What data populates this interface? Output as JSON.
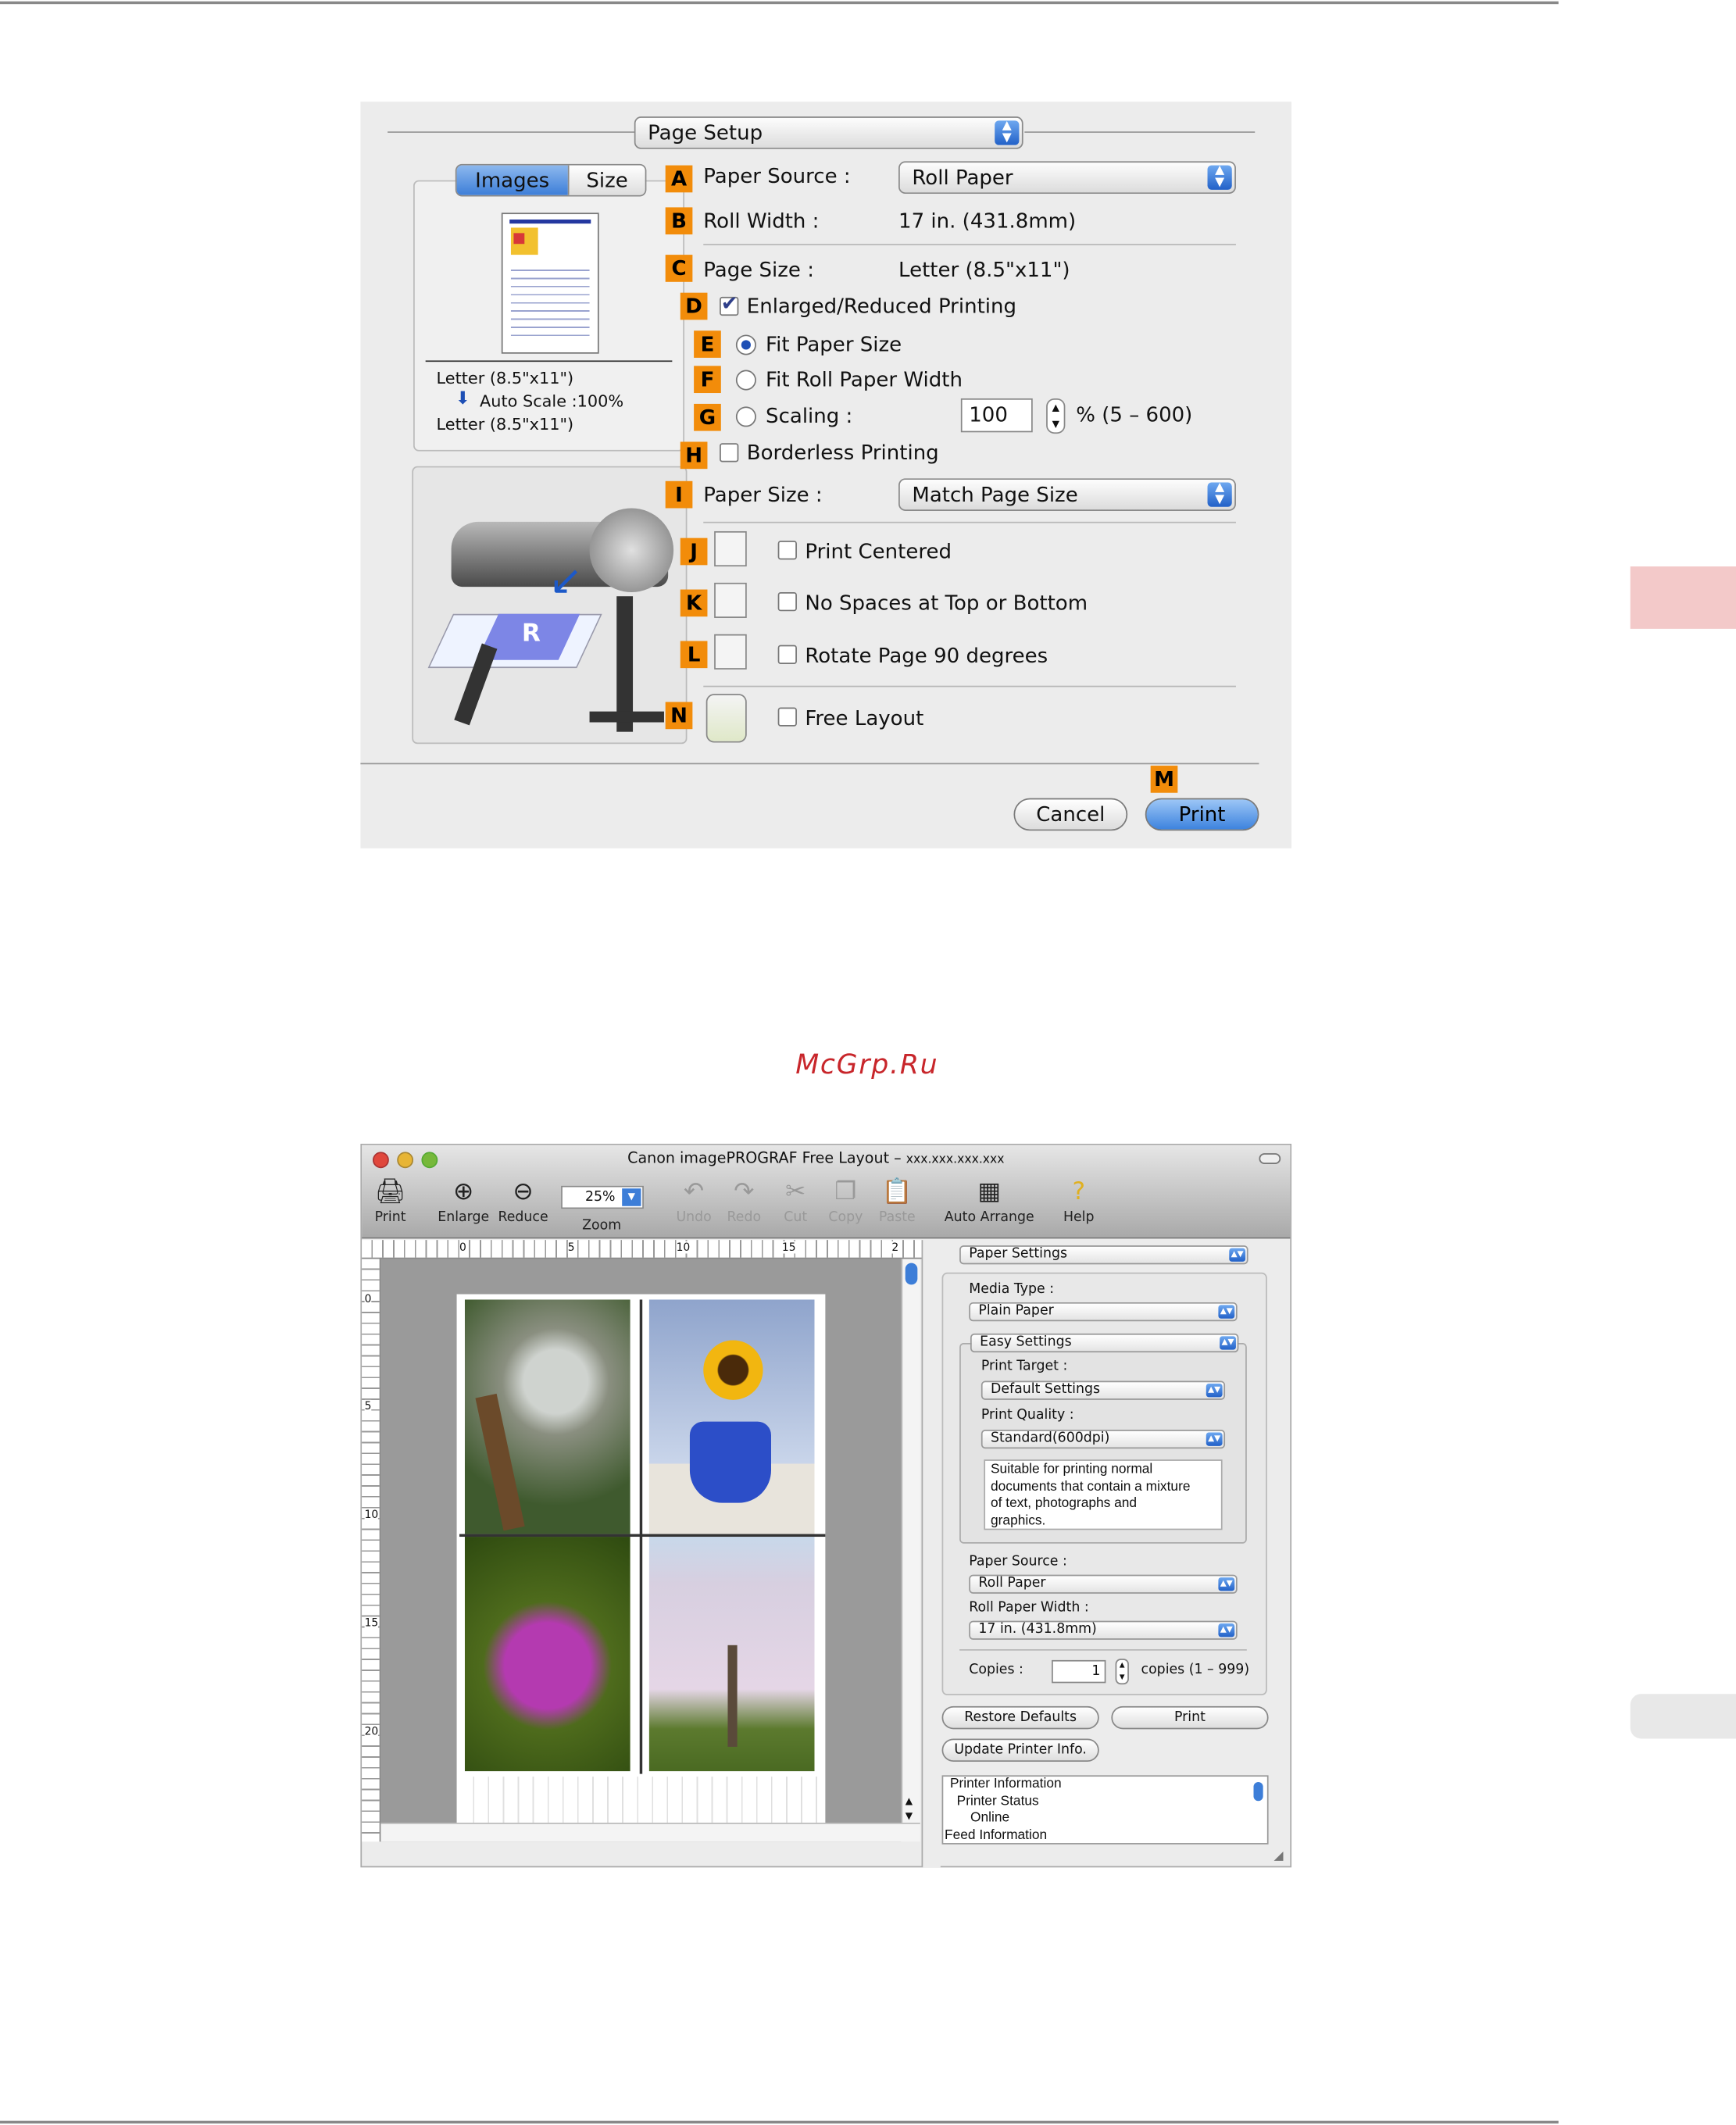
{
  "page_setup": {
    "title_popup": "Page Setup",
    "tabs": [
      "Images",
      "Size"
    ],
    "preview": {
      "line1": "Letter (8.5\"x11\")",
      "line2": "Auto Scale :100%",
      "line3": "Letter (8.5\"x11\")"
    },
    "markers": {
      "a": "A",
      "b": "B",
      "c": "C",
      "d": "D",
      "e": "E",
      "f": "F",
      "g": "G",
      "h": "H",
      "i": "I",
      "j": "J",
      "k": "K",
      "l": "L",
      "n": "N",
      "m": "M"
    },
    "paper_source_label": "Paper Source :",
    "paper_source_value": "Roll Paper",
    "roll_width_label": "Roll Width :",
    "roll_width_value": "17 in. (431.8mm)",
    "page_size_label": "Page Size :",
    "page_size_value": "Letter (8.5\"x11\")",
    "enlarged_reduced": "Enlarged/Reduced Printing",
    "fit_paper_size": "Fit Paper Size",
    "fit_roll_width": "Fit Roll Paper Width",
    "scaling_label": "Scaling :",
    "scaling_value": "100",
    "scaling_range": "% (5 – 600)",
    "borderless": "Borderless Printing",
    "paper_size_label": "Paper Size :",
    "paper_size_value": "Match Page Size",
    "print_centered": "Print Centered",
    "no_spaces": "No Spaces at Top or Bottom",
    "rotate": "Rotate Page 90 degrees",
    "free_layout": "Free Layout",
    "cancel": "Cancel",
    "print": "Print"
  },
  "watermark": "McGrp.Ru",
  "app": {
    "title": "Canon imagePROGRAF Free Layout –",
    "title_suffix": "xxx.xxx.xxx.xxx",
    "toolbar": {
      "print": "Print",
      "enlarge": "Enlarge",
      "reduce": "Reduce",
      "zoom_value": "25%",
      "zoom": "Zoom",
      "undo": "Undo",
      "redo": "Redo",
      "cut": "Cut",
      "copy": "Copy",
      "paste": "Paste",
      "auto_arrange": "Auto Arrange",
      "help": "Help"
    },
    "ruler_h": [
      "0",
      "5",
      "10",
      "15",
      "2"
    ],
    "ruler_v": [
      "0",
      "5",
      "10",
      "15",
      "20"
    ],
    "panel": {
      "top_popup": "Paper Settings",
      "media_type_label": "Media Type :",
      "media_type": "Plain Paper",
      "easy_settings": "Easy Settings",
      "print_target_label": "Print Target :",
      "print_target": "Default Settings",
      "print_quality_label": "Print Quality :",
      "print_quality": "Standard(600dpi)",
      "description": "Suitable for printing normal documents that contain a mixture of text, photographs and graphics.",
      "paper_source_label": "Paper Source :",
      "paper_source": "Roll Paper",
      "roll_width_label": "Roll Paper Width :",
      "roll_width": "17 in. (431.8mm)",
      "copies_label": "Copies :",
      "copies_value": "1",
      "copies_range": "copies (1 – 999)",
      "restore_defaults": "Restore Defaults",
      "print": "Print",
      "update_printer": "Update Printer Info.",
      "info": [
        "Printer Information",
        "Printer Status",
        "Online",
        "Feed Information"
      ]
    }
  },
  "colors": {
    "marker": "#f28c0a",
    "side_tab": "#f3c9c9",
    "accent": "#3d83de"
  }
}
